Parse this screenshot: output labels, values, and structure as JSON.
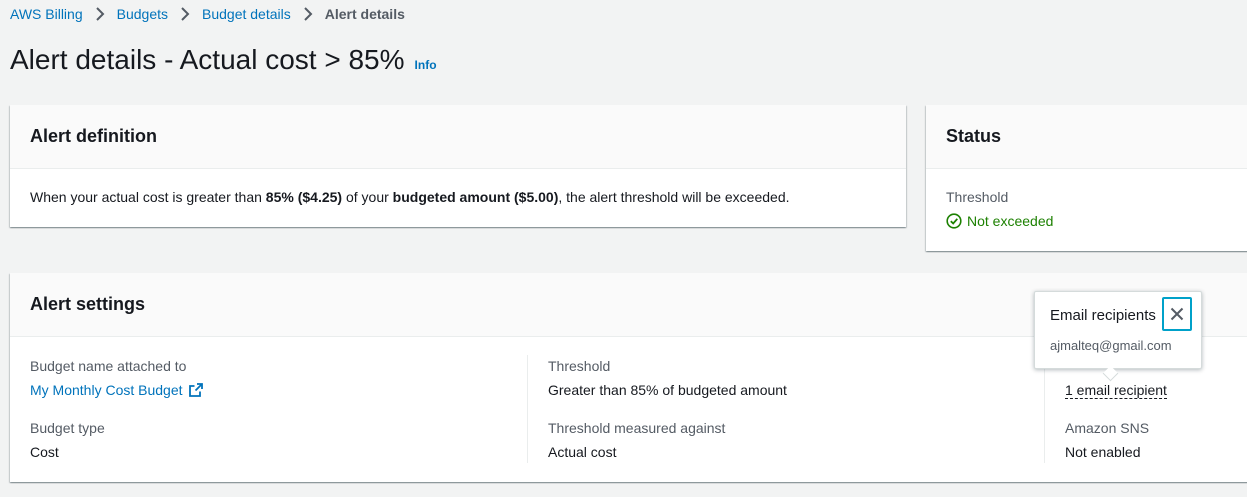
{
  "breadcrumb": {
    "items": [
      "AWS Billing",
      "Budgets",
      "Budget details"
    ],
    "current": "Alert details"
  },
  "page": {
    "title": "Alert details - Actual cost > 85%",
    "info": "Info"
  },
  "alert_definition": {
    "header": "Alert definition",
    "text_1": "When your actual cost is greater than ",
    "bold_1": "85% ($4.25)",
    "text_2": " of your ",
    "bold_2": "budgeted amount ($5.00)",
    "text_3": ", the alert threshold will be exceeded."
  },
  "status": {
    "header": "Status",
    "threshold_label": "Threshold",
    "threshold_value": "Not exceeded"
  },
  "alert_settings": {
    "header": "Alert settings",
    "budget_name_label": "Budget name attached to",
    "budget_name_value": "My Monthly Cost Budget",
    "budget_type_label": "Budget type",
    "budget_type_value": "Cost",
    "threshold_label": "Threshold",
    "threshold_value": "Greater than 85% of budgeted amount",
    "measured_label": "Threshold measured against",
    "measured_value": "Actual cost",
    "recipients_value": "1 email recipient",
    "sns_label": "Amazon SNS",
    "sns_value": "Not enabled"
  },
  "popover": {
    "title": "Email recipients",
    "email": "ajmalteq@gmail.com"
  },
  "colors": {
    "link": "#0073bb",
    "success": "#1d8102",
    "focus": "#00a1c9"
  }
}
